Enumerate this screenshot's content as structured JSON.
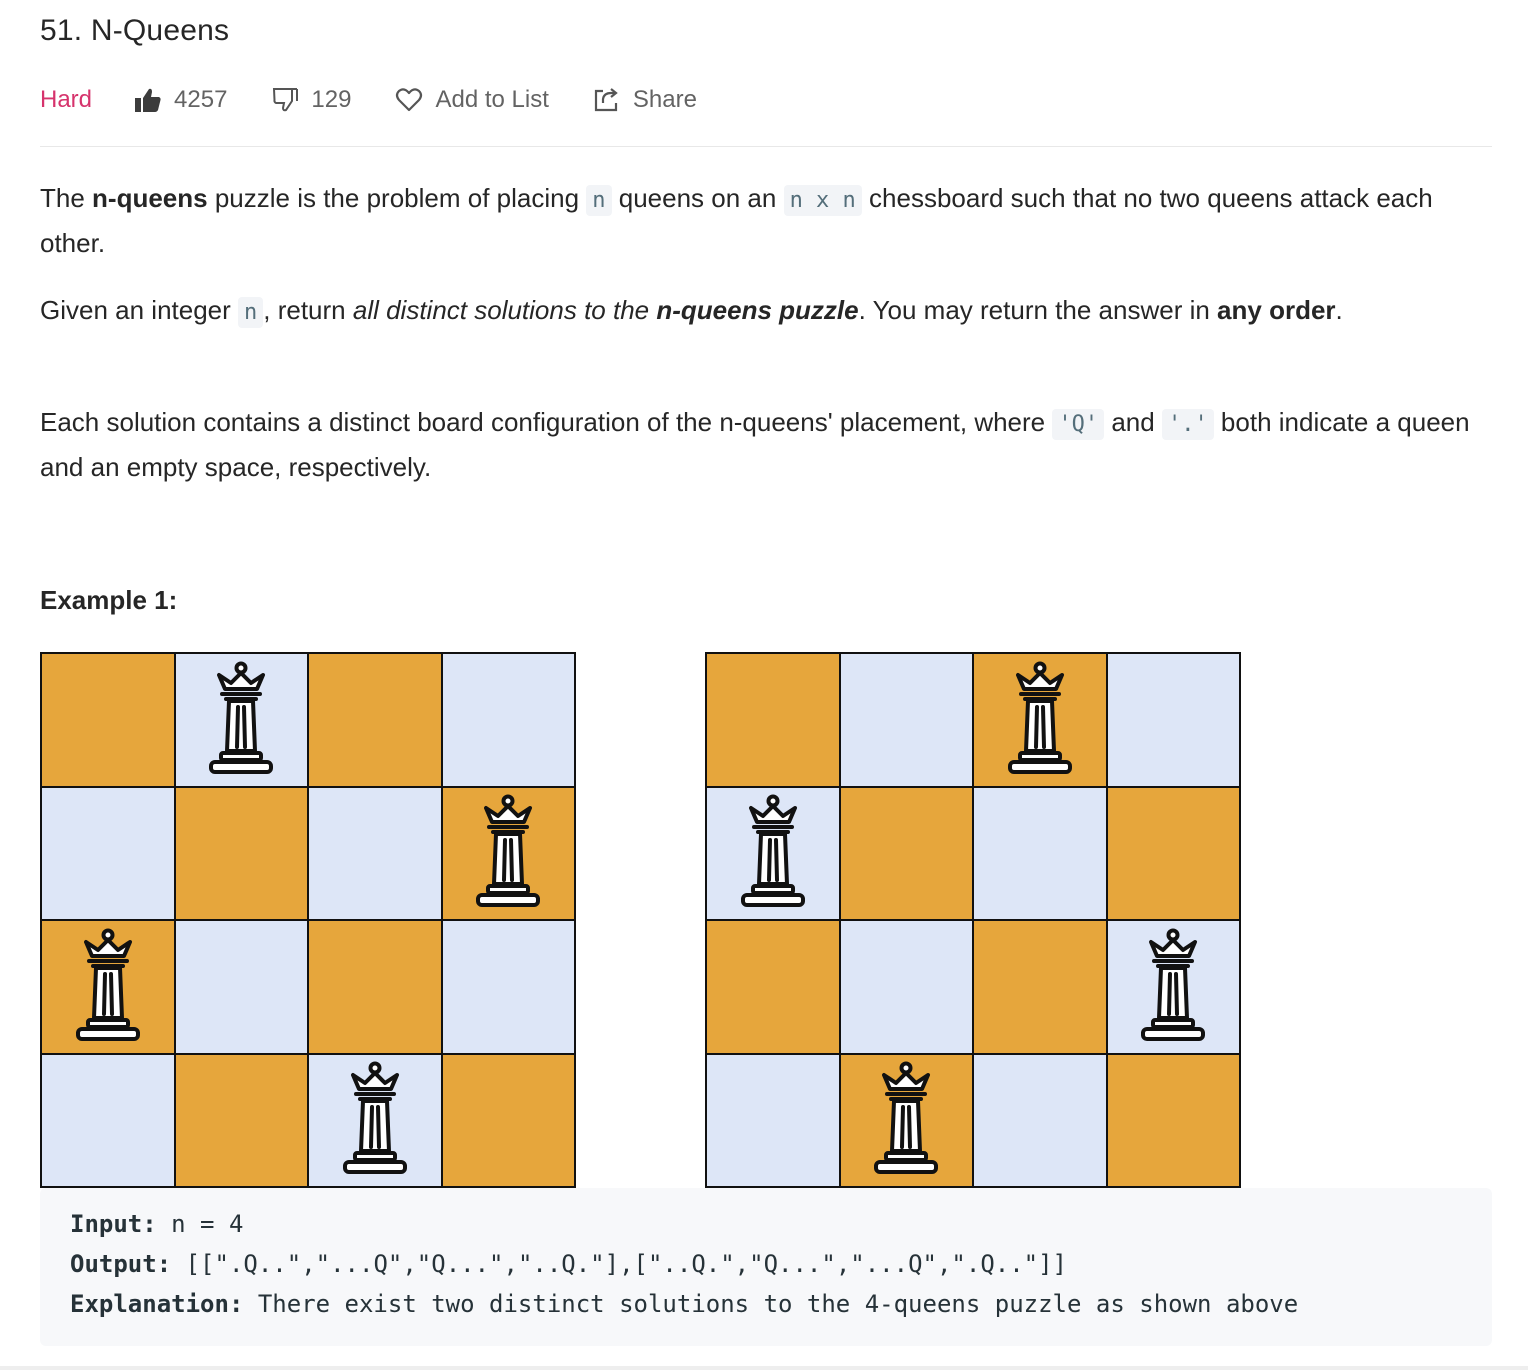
{
  "problem": {
    "title": "51. N-Queens",
    "difficulty": "Hard",
    "likes": "4257",
    "dislikes": "129",
    "add_to_list": "Add to List",
    "share": "Share"
  },
  "description": {
    "p1": {
      "t1": "The ",
      "b1": "n-queens",
      "t2": " puzzle is the problem of placing ",
      "c1": "n",
      "t3": " queens on an ",
      "c2": "n x n",
      "t4": " chessboard such that no two queens attack each other."
    },
    "p2": {
      "t1": "Given an integer ",
      "c1": "n",
      "t2": ", return ",
      "i1": "all distinct solutions to the ",
      "ib1": "n-queens puzzle",
      "t3": ". You may return the answer in ",
      "b1": "any order",
      "t4": "."
    },
    "p3": {
      "t1": "Each solution contains a distinct board configuration of the n-queens' placement, where ",
      "c1": "'Q'",
      "t2": " and ",
      "c2": "'.'",
      "t3": " both indicate a queen and an empty space, respectively."
    }
  },
  "example": {
    "title": "Example 1:",
    "boards": [
      [
        ".Q..",
        "...Q",
        "Q...",
        "..Q."
      ],
      [
        "..Q.",
        "Q...",
        "...Q",
        ".Q.."
      ]
    ],
    "colors": {
      "orange": "#e6a63c",
      "light_blue": "#dde6f7",
      "border": "#111111"
    },
    "input_label": "Input:",
    "input_value": " n = 4",
    "output_label": "Output:",
    "output_value": " [[\".Q..\",\"...Q\",\"Q...\",\"..Q.\"],[\"..Q.\",\"Q...\",\"...Q\",\".Q..\"]]",
    "explanation_label": "Explanation:",
    "explanation_value": " There exist two distinct solutions to the 4-queens puzzle as shown above"
  },
  "colors": {
    "hard": "#d6336c",
    "meta_text": "#636363",
    "code_bg": "#f7f8fa"
  }
}
